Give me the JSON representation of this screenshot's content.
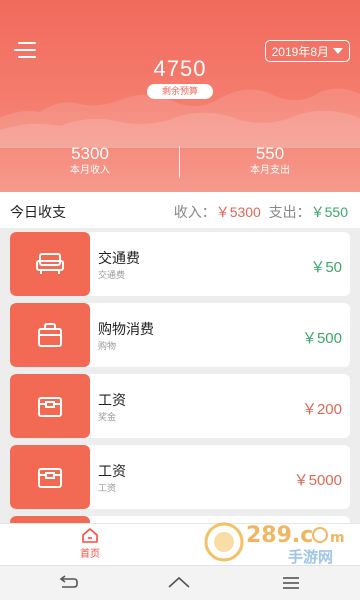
{
  "header": {
    "month_label": "2019年8月",
    "budget_amount": "4750",
    "budget_caption": "剩余预算",
    "stats": [
      {
        "value": "5300",
        "label": "本月收入"
      },
      {
        "value": "550",
        "label": "本月支出"
      }
    ]
  },
  "today": {
    "title": "今日收支",
    "income_label": "收入：",
    "income_value": "￥5300",
    "expense_label": "支出：",
    "expense_value": "￥550"
  },
  "records": [
    {
      "name": "交通费",
      "sub": "交通费",
      "amount": "￥50",
      "type": "expense",
      "icon": "sofa-icon"
    },
    {
      "name": "购物消费",
      "sub": "购物",
      "amount": "￥500",
      "type": "expense",
      "icon": "shopping-bag-icon"
    },
    {
      "name": "工资",
      "sub": "奖金",
      "amount": "￥200",
      "type": "income",
      "icon": "box-icon"
    },
    {
      "name": "工资",
      "sub": "工资",
      "amount": "￥5000",
      "type": "income",
      "icon": "box-icon"
    }
  ],
  "tabbar": {
    "home_label": "首页"
  },
  "colors": {
    "accent": "#f26a5c",
    "income": "#e06656",
    "expense": "#3aa86b",
    "tab_active": "#ff4a3b"
  }
}
